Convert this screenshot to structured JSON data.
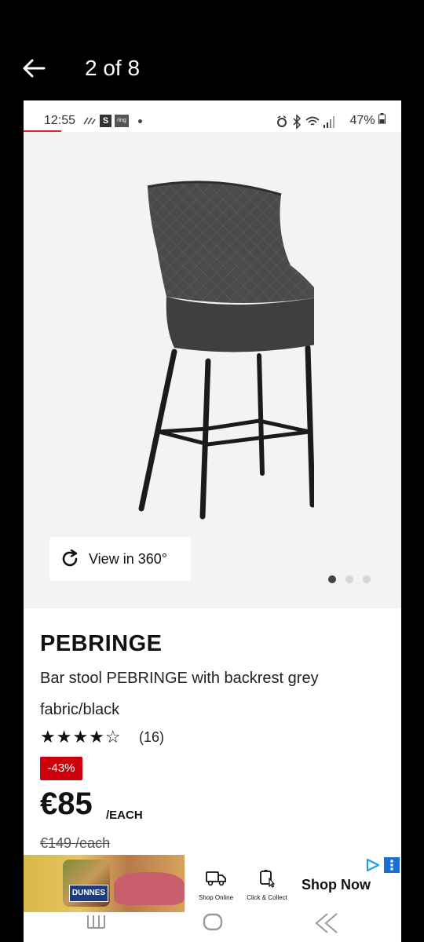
{
  "viewer": {
    "pager": "2 of 8"
  },
  "status_bar": {
    "time": "12:55",
    "s_badge": "S",
    "ring_badge": "ring",
    "battery": "47%"
  },
  "gallery": {
    "view360_label": "View in 360°",
    "dot_count": 3,
    "active_dot": 0
  },
  "product": {
    "name": "PEBRINGE",
    "description": "Bar stool PEBRINGE with backrest grey fabric/black",
    "rating": 4,
    "rating_max": 5,
    "review_count": "(16)",
    "discount": "-43%",
    "price": "€85",
    "price_unit": "/EACH",
    "old_price": "€149 /each"
  },
  "ad": {
    "brand": "DUNNES",
    "shop_online": "Shop Online",
    "click_collect": "Click & Collect",
    "cta": "Shop Now"
  },
  "colors": {
    "accent_red": "#cc0008",
    "status_underline": "#d8233a",
    "viewer_bg": "#000000"
  }
}
